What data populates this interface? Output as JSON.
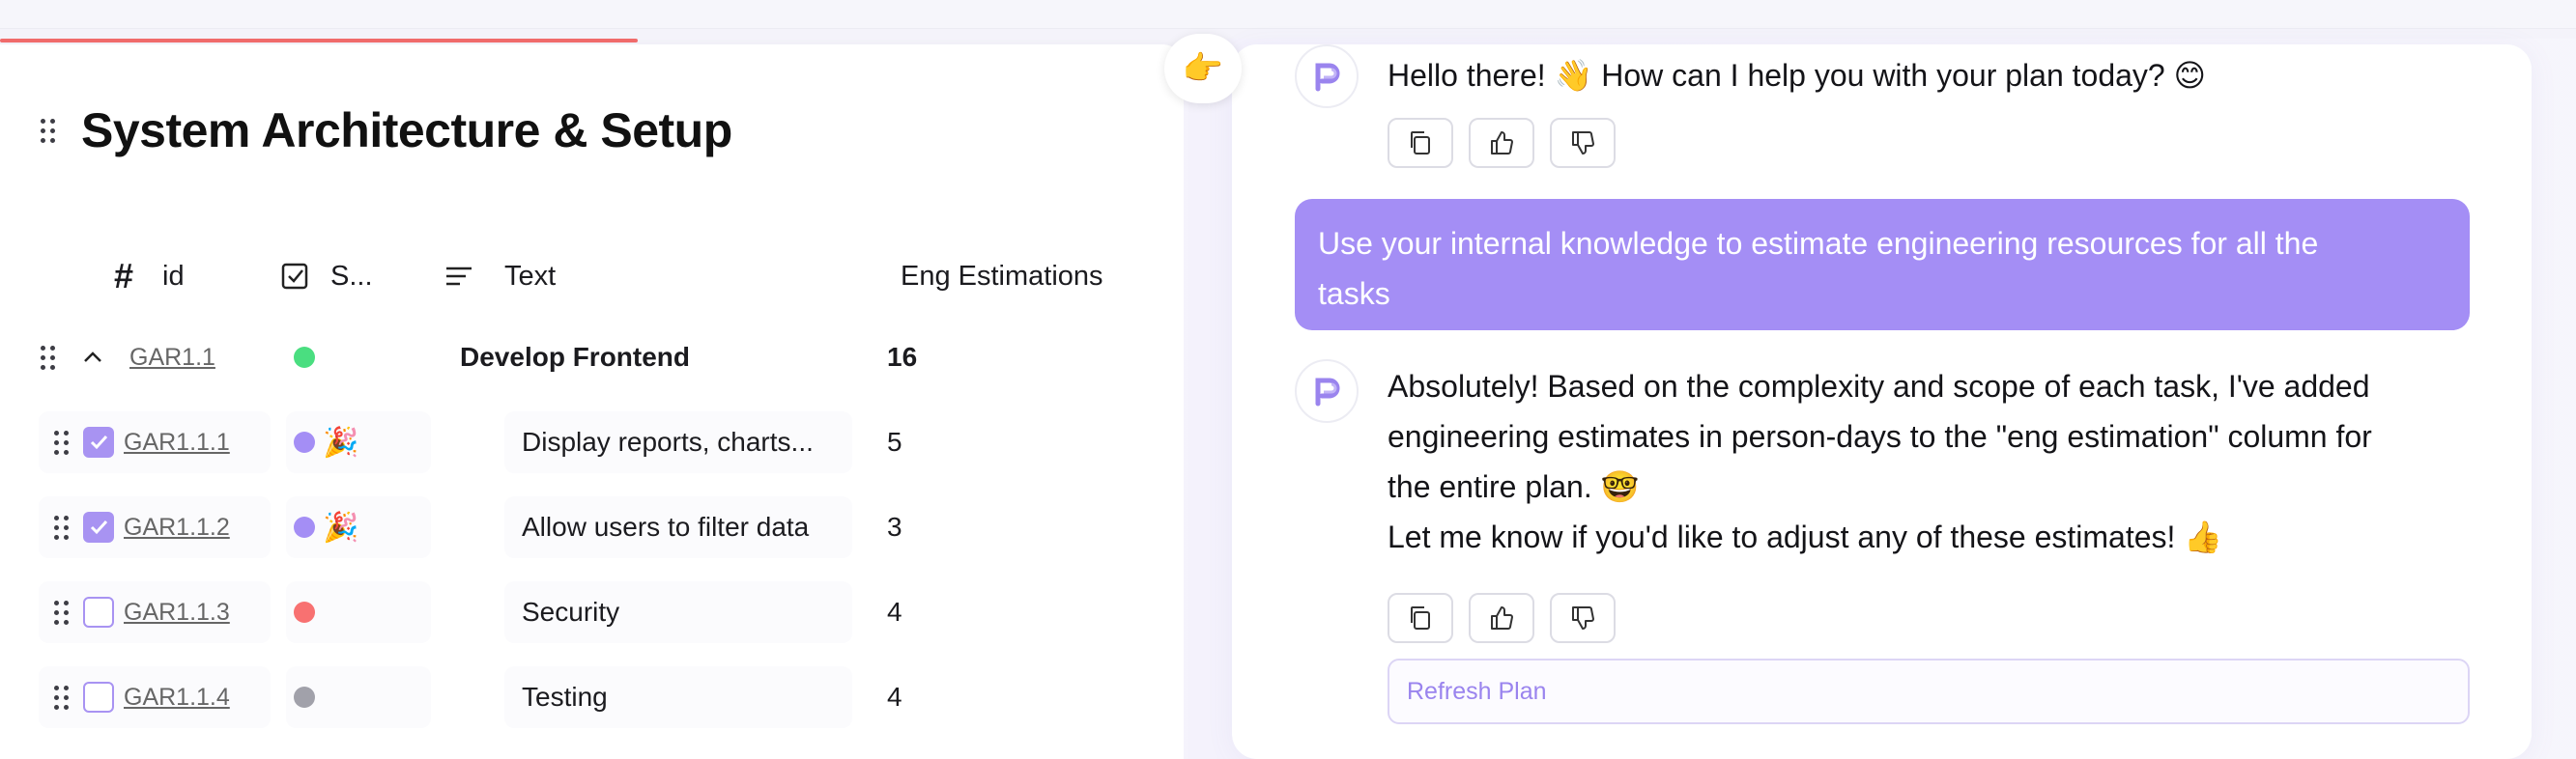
{
  "section": {
    "title": "System Architecture & Setup"
  },
  "table": {
    "headers": {
      "id": "id",
      "status": "S...",
      "text": "Text",
      "eng": "Eng Estimations"
    },
    "parent": {
      "id": "GAR1.1",
      "text": "Develop Frontend",
      "eng": "16",
      "status_color": "#4ade80"
    },
    "rows": [
      {
        "id": "GAR1.1.1",
        "checked": true,
        "status_color": "#a48ef5",
        "emoji": "🎉",
        "text": "Display reports, charts...",
        "eng": "5"
      },
      {
        "id": "GAR1.1.2",
        "checked": true,
        "status_color": "#a48ef5",
        "emoji": "🎉",
        "text": "Allow users to filter data",
        "eng": "3"
      },
      {
        "id": "GAR1.1.3",
        "checked": false,
        "status_color": "#f87171",
        "emoji": "",
        "text": "Security",
        "eng": "4"
      },
      {
        "id": "GAR1.1.4",
        "checked": false,
        "status_color": "#a1a1aa",
        "emoji": "",
        "text": "Testing",
        "eng": "4"
      }
    ]
  },
  "handle": {
    "emoji": "👉"
  },
  "chat": {
    "assistant_greeting": "Hello there! 👋 How can I help you with your plan today? 😊",
    "user_message_line1": "Use your internal knowledge to estimate engineering resources for all the",
    "user_message_line2": "tasks",
    "assistant_reply": {
      "line1": "Absolutely! Based on the complexity and scope of each task, I've added",
      "line2": "engineering estimates in person-days to the \"eng estimation\" column for",
      "line3": "the entire plan. 🤓",
      "line4": "Let me know if you'd like to adjust any of these estimates! 👍"
    },
    "refresh_label": "Refresh Plan"
  },
  "colors": {
    "accent": "#a48ef5",
    "progress": "#f06b6b"
  }
}
